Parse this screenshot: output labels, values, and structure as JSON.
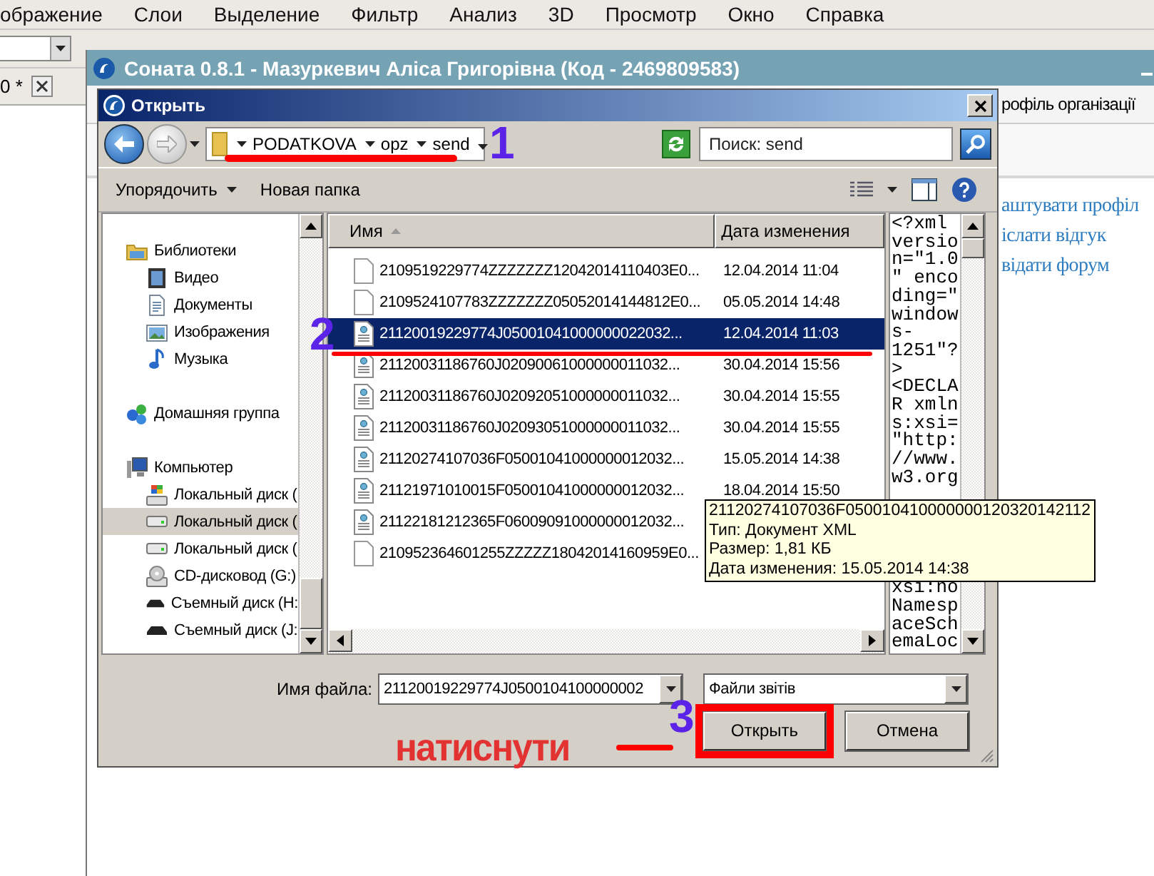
{
  "app_menu": {
    "items": [
      "ображение",
      "Слои",
      "Выделение",
      "Фильтр",
      "Анализ",
      "3D",
      "Просмотр",
      "Окно",
      "Справка"
    ]
  },
  "app_toolbar": {
    "tab_label": "0 *"
  },
  "main_window": {
    "title": "Соната 0.8.1 - Мазуркевич Аліса Григорівна (Код - 2469809583)",
    "tab": "рофіль організації",
    "links": [
      "аштувати профіл",
      "іслати відгук",
      "відати форум"
    ]
  },
  "open_dialog": {
    "title": "Открыть",
    "breadcrumb": [
      "PODATKOVA",
      "opz",
      "send"
    ],
    "search": {
      "placeholder": "Поиск: send"
    },
    "toolbar": {
      "organize": "Упорядочить",
      "new_folder": "Новая папка"
    },
    "nav": [
      {
        "label": "Библиотеки",
        "kind": "folder",
        "selected": false,
        "children": [
          {
            "label": "Видео",
            "kind": "video",
            "selected": false
          },
          {
            "label": "Документы",
            "kind": "docs",
            "selected": false
          },
          {
            "label": "Изображения",
            "kind": "images",
            "selected": false
          },
          {
            "label": "Музыка",
            "kind": "music",
            "selected": false
          }
        ]
      },
      {
        "label": "Домашняя группа",
        "kind": "homegroup",
        "selected": false
      },
      {
        "label": "Компьютер",
        "kind": "computer",
        "selected": false,
        "children": [
          {
            "label": "Локальный диск (",
            "kind": "sysdisk",
            "selected": false
          },
          {
            "label": "Локальный диск (",
            "kind": "disk",
            "selected": true
          },
          {
            "label": "Локальный диск (",
            "kind": "disk",
            "selected": false
          },
          {
            "label": "CD-дисковод (G:)",
            "kind": "cd",
            "selected": false
          },
          {
            "label": "Съемный диск (H:",
            "kind": "removable",
            "selected": false
          },
          {
            "label": "Съемный диск (J:",
            "kind": "removable",
            "selected": false
          }
        ]
      }
    ],
    "columns": [
      {
        "label": "Имя",
        "sorted": true
      },
      {
        "label": "Дата изменения",
        "sorted": false
      }
    ],
    "files": [
      {
        "name": "2109519229774ZZZZZZZ12042014110403E0...",
        "date": "12.04.2014 11:04",
        "kind": "plain",
        "selected": false
      },
      {
        "name": "2109524107783ZZZZZZZ05052014144812E0...",
        "date": "05.05.2014 14:48",
        "kind": "plain",
        "selected": false
      },
      {
        "name": "21120019229774J05001041000000022032...",
        "date": "12.04.2014 11:03",
        "kind": "xml",
        "selected": true
      },
      {
        "name": "21120031186760J02090061000000011032...",
        "date": "30.04.2014 15:56",
        "kind": "xml",
        "selected": false
      },
      {
        "name": "21120031186760J02092051000000011032...",
        "date": "30.04.2014 15:55",
        "kind": "xml",
        "selected": false
      },
      {
        "name": "21120031186760J02093051000000011032...",
        "date": "30.04.2014 15:55",
        "kind": "xml",
        "selected": false
      },
      {
        "name": "21120274107036F05001041000000012032...",
        "date": "15.05.2014 14:38",
        "kind": "xml",
        "selected": false
      },
      {
        "name": "21121971010015F05001041000000012032...",
        "date": "18.04.2014 15:50",
        "kind": "xml",
        "selected": false
      },
      {
        "name": "21122181212365F06009091000000012032...",
        "kind": "xml",
        "selected": false
      },
      {
        "name": "210952364601255ZZZZZ18042014160959E0...",
        "kind": "plain",
        "selected": false
      }
    ],
    "preview": {
      "lines_top": [
        "<?xml",
        "versio",
        "n=\"1.0",
        "\" enco",
        "ding=\"",
        "window",
        "s-",
        "1251\"?",
        ">",
        "<DECLA",
        "R xmln",
        "s:xsi=",
        "\"http:",
        "//www.",
        "w3.org"
      ],
      "lines_bottom": [
        "xsi:no",
        "Namesp",
        "aceSch",
        "emaLoc"
      ]
    },
    "tooltip": {
      "lines": [
        "21120274107036F050010410000000120320142112",
        "Тип: Документ XML",
        "Размер: 1,81 КБ",
        "Дата изменения: 15.05.2014 14:38"
      ]
    },
    "filename": {
      "label": "Имя файла:",
      "value": "21120019229774J0500104100000002"
    },
    "filter": {
      "value": "Файли звітів"
    },
    "buttons": [
      "Открыть",
      "Отмена"
    ]
  },
  "annotations": [
    {
      "kind": "step",
      "text": "1"
    },
    {
      "kind": "step",
      "text": "2"
    },
    {
      "kind": "step",
      "text": "3"
    },
    {
      "kind": "note",
      "text": "натиснути"
    }
  ]
}
